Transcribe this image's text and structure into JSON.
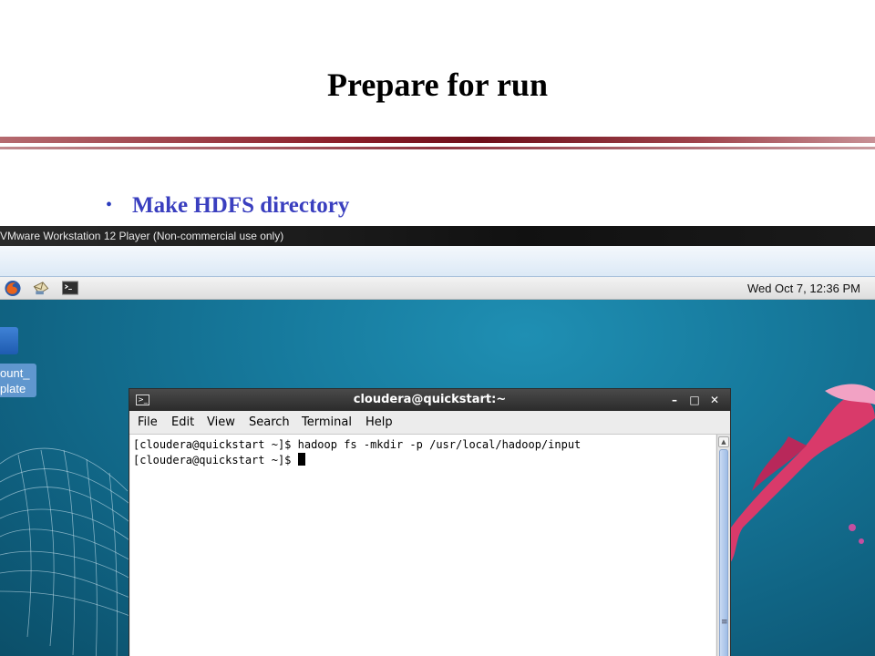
{
  "slide": {
    "title": "Prepare for run",
    "bullet": "Make HDFS directory"
  },
  "vmware": {
    "window_title": "VMware Workstation 12 Player (Non-commercial use only)"
  },
  "panel": {
    "clock": "Wed Oct  7, 12:36 PM",
    "launchers": [
      "firefox-icon",
      "email-icon",
      "terminal-icon"
    ]
  },
  "desktop": {
    "icon_label_line1": "ount_",
    "icon_label_line2": "plate"
  },
  "terminal": {
    "title": "cloudera@quickstart:~",
    "buttons": {
      "minimize": "–",
      "maximize": "□",
      "close": "✕"
    },
    "menu": {
      "file": "File",
      "edit": "Edit",
      "view": "View",
      "search": "Search",
      "terminal": "Terminal",
      "help": "Help"
    },
    "lines": [
      "[cloudera@quickstart ~]$ hadoop fs -mkdir -p /usr/local/hadoop/input",
      "[cloudera@quickstart ~]$ "
    ]
  },
  "colors": {
    "slide_title": "#000000",
    "bullet_text": "#3a3fbf",
    "rule": "#8a1d28",
    "desktop_bg": "#16799c"
  }
}
